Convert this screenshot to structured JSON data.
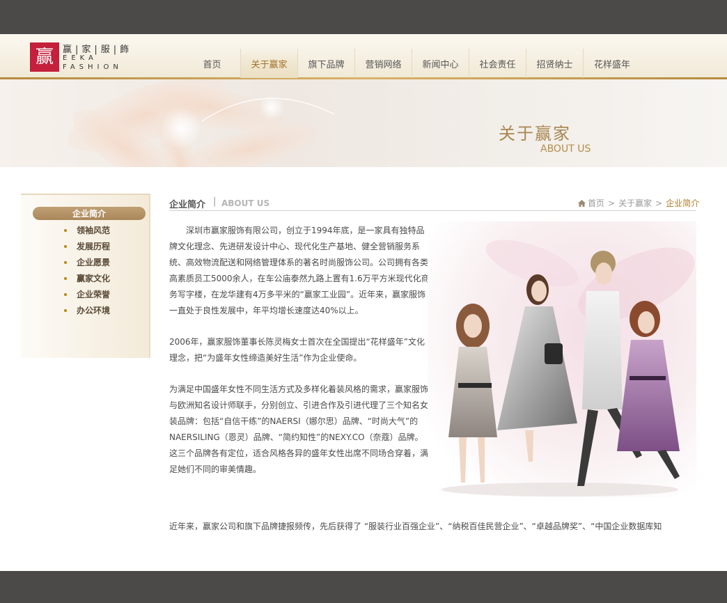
{
  "logo": {
    "glyph": "赢",
    "name_cn": "赢|家|服|飾",
    "name_en_1": "EEKA",
    "name_en_2": "FASHION",
    "brand_color": "#c41f3b"
  },
  "nav": {
    "items": [
      {
        "label": "首页"
      },
      {
        "label": "关于赢家"
      },
      {
        "label": "旗下品牌"
      },
      {
        "label": "营销网络"
      },
      {
        "label": "新闻中心"
      },
      {
        "label": "社会责任"
      },
      {
        "label": "招贤纳士"
      },
      {
        "label": "花样盛年"
      }
    ],
    "active_index": 1
  },
  "banner": {
    "title": "关于赢家",
    "subtitle": "ABOUT US"
  },
  "sidebar": {
    "active": "企业简介",
    "items": [
      {
        "label": "领袖风范"
      },
      {
        "label": "发展历程"
      },
      {
        "label": "企业愿景"
      },
      {
        "label": "赢家文化"
      },
      {
        "label": "企业荣誉"
      },
      {
        "label": "办公环境"
      }
    ]
  },
  "section": {
    "title": "企业简介",
    "separator": "|",
    "title_en": "ABOUT US"
  },
  "breadcrumb": {
    "home": "首页",
    "sep": ">",
    "parent": "关于赢家",
    "current": "企业简介"
  },
  "content": {
    "p1": "深圳市赢家服饰有限公司，创立于1994年底，是一家具有独特品牌文化理念、先进研发设计中心、现代化生产基地、健全营销服务系统、高效物流配送和网络管理体系的著名时尚服饰公司。公司拥有各类高素质员工5000余人，在车公庙泰然九路上置有1.6万平方米现代化商务写字楼，在龙华建有4万多平米的“赢家工业园”。近年来，赢家服饰一直处于良性发展中，年平均增长速度达40%以上。",
    "p2": "2006年，赢家服饰董事长陈灵梅女士首次在全国提出“花样盛年”文化理念，把“为盛年女性缔造美好生活”作为企业使命。",
    "p3": "为满足中国盛年女性不同生活方式及多样化着装风格的需求，赢家服饰与欧洲知名设计师联手，分别创立、引进合作及引进代理了三个知名女装品牌：包括“自信干练”的NAERSI（娜尔思）品牌、“时尚大气”的NAERSILING（恩灵）品牌、“简约知性”的NEXY.CO（奈蔻）品牌。这三个品牌各有定位，适合风格各异的盛年女性出席不同场合穿着，满足她们不同的审美情趣。",
    "p4": "近年来，赢家公司和旗下品牌捷报频传，先后获得了 “服装行业百强企业”、“纳税百佳民营企业”、“卓越品牌奖”、“中国企业数据库知"
  },
  "colors": {
    "top_bar": "#4b4a48",
    "accent_gold": "#b07c2a",
    "sidebar_active": "#a9875a"
  }
}
